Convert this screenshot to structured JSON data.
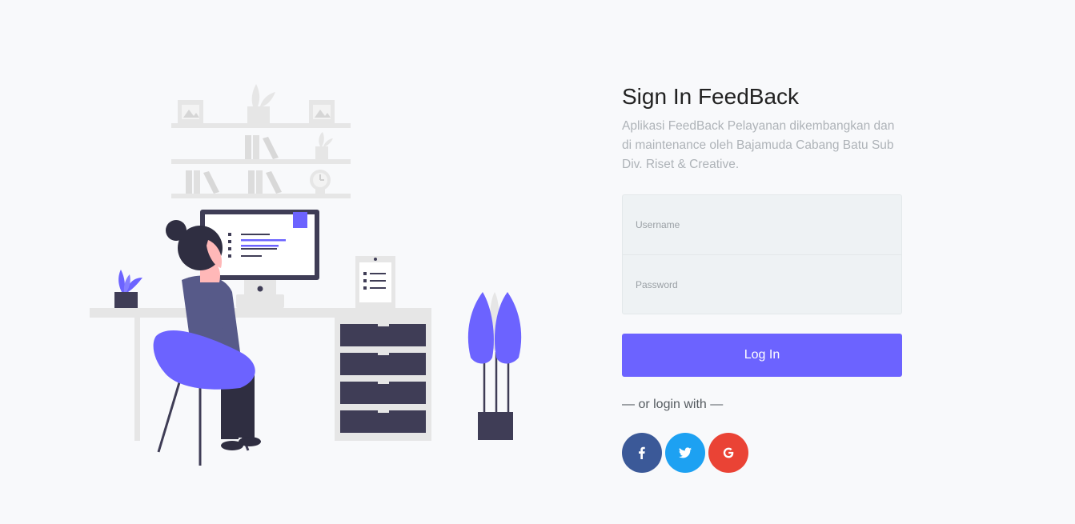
{
  "form": {
    "title": "Sign In FeedBack",
    "description": "Aplikasi FeedBack Pelayanan dikembangkan dan di maintenance oleh Bajamuda Cabang Batu Sub Div. Riset & Creative.",
    "username_placeholder": "Username",
    "username_value": "",
    "password_placeholder": "Password",
    "password_value": "",
    "login_label": "Log In",
    "or_text": "— or login with —"
  },
  "socials": [
    {
      "name": "facebook",
      "icon": "facebook-icon",
      "color": "#3b5998"
    },
    {
      "name": "twitter",
      "icon": "twitter-icon",
      "color": "#1da1f2"
    },
    {
      "name": "google",
      "icon": "google-icon",
      "color": "#ea4335"
    }
  ],
  "colors": {
    "accent": "#6c63ff",
    "background": "#f8f9fb",
    "illustration_gray": "#e6e6e6",
    "illustration_dark": "#3f3d56"
  }
}
